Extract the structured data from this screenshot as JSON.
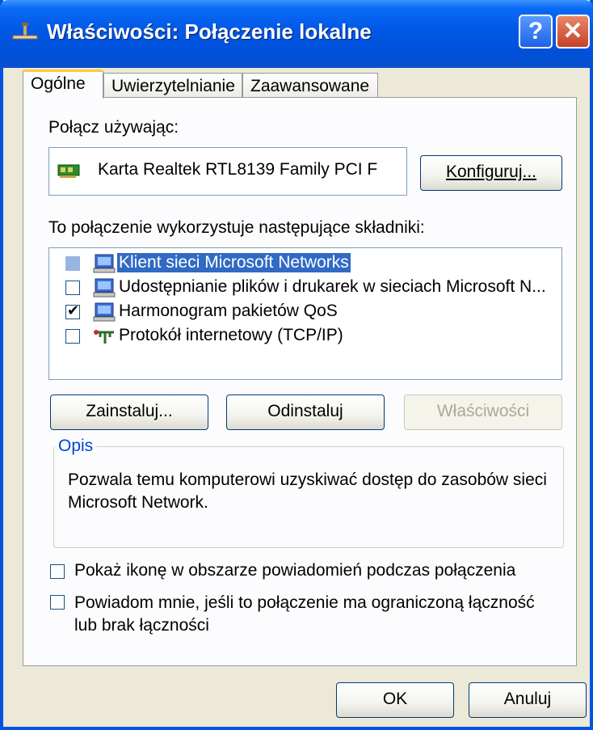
{
  "window": {
    "title": "Właściwości: Połączenie lokalne",
    "help_label": "?",
    "close_label": "✕"
  },
  "tabs": [
    {
      "label": "Ogólne",
      "active": true
    },
    {
      "label": "Uwierzytelnianie",
      "active": false
    },
    {
      "label": "Zaawansowane",
      "active": false
    }
  ],
  "connect_using": {
    "label": "Połącz używając:",
    "adapter": "Karta Realtek RTL8139 Family PCI F",
    "configure_button": "Konfiguruj..."
  },
  "components": {
    "label": "To połączenie wykorzystuje następujące składniki:",
    "items": [
      {
        "label": "Klient sieci Microsoft Networks",
        "checked": false,
        "selected": true,
        "icon": "network-client-icon"
      },
      {
        "label": "Udostępnianie plików i drukarek w sieciach Microsoft N...",
        "checked": false,
        "selected": false,
        "icon": "network-service-icon"
      },
      {
        "label": "Harmonogram pakietów QoS",
        "checked": true,
        "selected": false,
        "icon": "network-service-icon"
      },
      {
        "label": "Protokół internetowy (TCP/IP)",
        "checked": false,
        "selected": false,
        "icon": "protocol-icon"
      }
    ]
  },
  "buttons": {
    "install": "Zainstaluj...",
    "uninstall": "Odinstaluj",
    "properties": "Właściwości"
  },
  "description": {
    "legend": "Opis",
    "text": "Pozwala temu komputerowi uzyskiwać dostęp do zasobów sieci Microsoft Network."
  },
  "options": {
    "show_icon": "Pokaż ikonę w obszarze powiadomień podczas połączenia",
    "notify": "Powiadom mnie, jeśli to połączenie ma ograniczoną łączność lub brak łączności"
  },
  "footer": {
    "ok": "OK",
    "cancel": "Anuluj"
  },
  "colors": {
    "titlebar": "#0058e6",
    "selection": "#316ac5",
    "group_legend": "#0046d5"
  }
}
